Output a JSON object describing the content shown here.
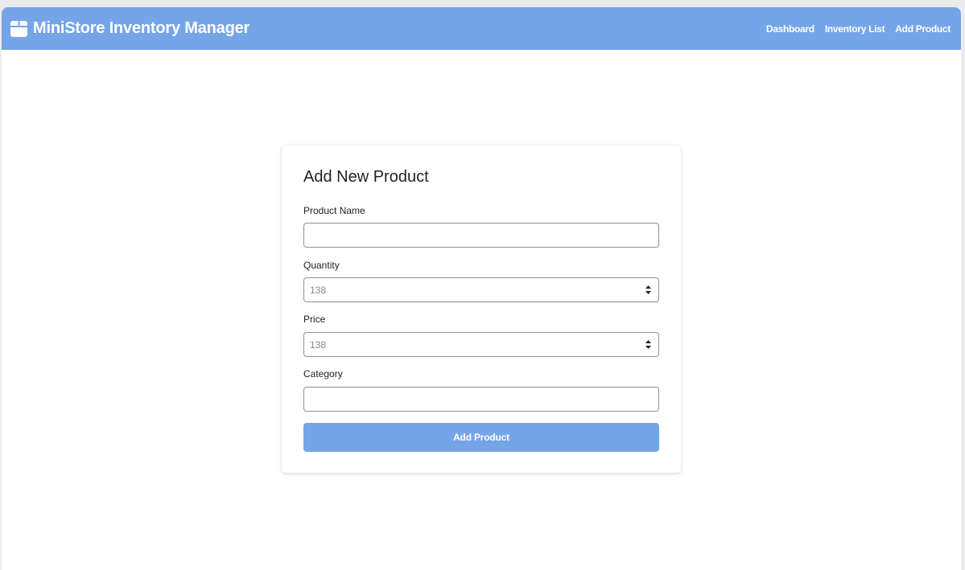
{
  "app": {
    "title": "MiniStore Inventory Manager",
    "brand_icon": "package-box-icon"
  },
  "nav": {
    "links": [
      {
        "label": "Dashboard"
      },
      {
        "label": "Inventory List"
      },
      {
        "label": "Add Product"
      }
    ]
  },
  "form": {
    "title": "Add New Product",
    "fields": {
      "product_name": {
        "label": "Product Name",
        "value": "",
        "placeholder": ""
      },
      "quantity": {
        "label": "Quantity",
        "value": "",
        "placeholder": "138"
      },
      "price": {
        "label": "Price",
        "value": "",
        "placeholder": "138"
      },
      "category": {
        "label": "Category",
        "value": "",
        "placeholder": ""
      }
    },
    "submit_label": "Add Product"
  },
  "colors": {
    "accent": "#75a5e8",
    "page_background": "#ebebeb",
    "card_background": "#ffffff"
  }
}
